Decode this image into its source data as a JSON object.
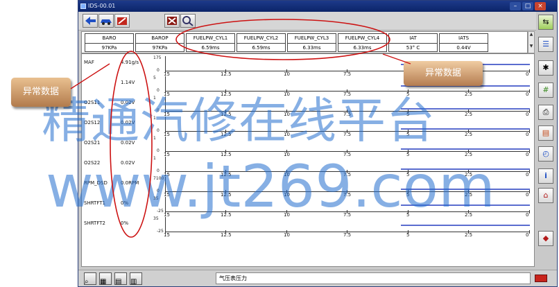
{
  "window": {
    "title": "IDS-00.01"
  },
  "pid_header": [
    {
      "name": "BARO",
      "value": "97KPa"
    },
    {
      "name": "BAROP",
      "value": "97KPa"
    },
    {
      "name": "FUELPW_CYL1",
      "value": "6.59ms"
    },
    {
      "name": "FUELPW_CYL2",
      "value": "6.59ms"
    },
    {
      "name": "FUELPW_CYL3",
      "value": "6.33ms"
    },
    {
      "name": "FUELPW_CYL4",
      "value": "6.33ms"
    },
    {
      "name": "IAT",
      "value": "53° C"
    },
    {
      "name": "IATS",
      "value": "0.44V"
    }
  ],
  "graphs": {
    "x_ticks": [
      "15",
      "12.5",
      "10",
      "7.5",
      "5",
      "2.5",
      "0"
    ],
    "rows": [
      {
        "name": "MAF",
        "value": "4.91g/s",
        "ymax": "175",
        "ymin": "0"
      },
      {
        "name": "",
        "value": "1.14V",
        "ymax": "5",
        "ymin": "0"
      },
      {
        "name": "O2S11",
        "value": "0.02V",
        "ymax": "1",
        "ymin": "0"
      },
      {
        "name": "O2S12",
        "value": "0.02V",
        "ymax": "1",
        "ymin": "0"
      },
      {
        "name": "O2S21",
        "value": "0.02V",
        "ymax": "1",
        "ymin": "0"
      },
      {
        "name": "O2S22",
        "value": "0.02V",
        "ymax": "1",
        "ymin": "0"
      },
      {
        "name": "RPM_DSD",
        "value": "0.0RPM",
        "ymax": "7100",
        "ymin": "0"
      },
      {
        "name": "SHRTFT1",
        "value": "0%",
        "ymax": "35",
        "ymin": "-25"
      },
      {
        "name": "SHRTFT2",
        "value": "0%",
        "ymax": "35",
        "ymin": "-25"
      }
    ]
  },
  "status": {
    "text": "气压表压力"
  },
  "callouts": {
    "left": "异常数据",
    "right": "异常数据"
  },
  "watermark": {
    "line1": "精通汽修在线平台",
    "line2": "www.jt269.com"
  },
  "icons": {
    "toolbar": [
      "back-arrow-icon",
      "car-icon",
      "tools-icon",
      "clear-icon",
      "search-icon"
    ],
    "sidebar": [
      "display-toggle-icon",
      "list-icon",
      "vehicle-icon",
      "wrench-icon",
      "print-icon",
      "window-icon",
      "timer-icon",
      "info-icon",
      "home-icon",
      "exit-icon"
    ]
  },
  "colors": {
    "trace": "#5a6ccf",
    "watermark": "#2f7ad0",
    "annotation": "#cc1111"
  }
}
